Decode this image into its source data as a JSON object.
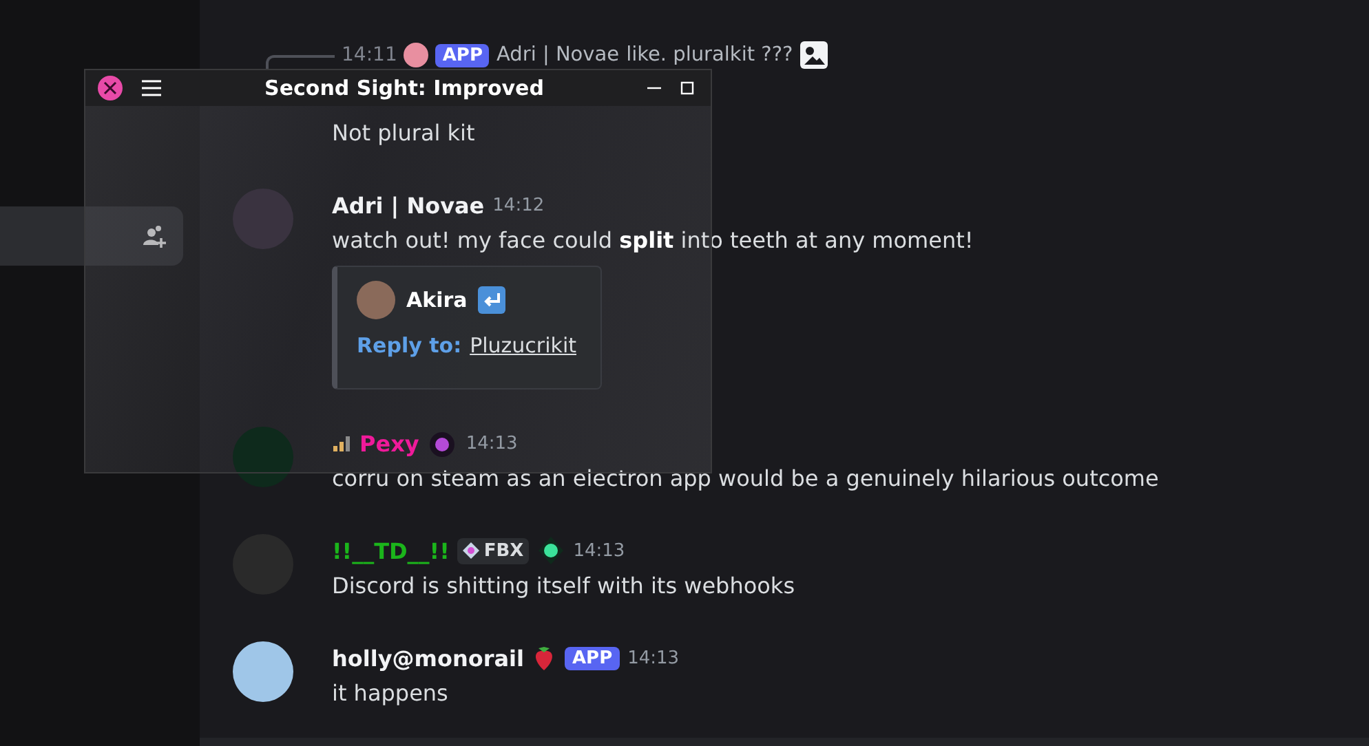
{
  "sidebar": {
    "items": [
      {
        "kind": "add-friend",
        "selected": true
      }
    ]
  },
  "overlay": {
    "title": "Second Sight: Improved"
  },
  "messages": [
    {
      "reply": {
        "time": "14:11",
        "badge": "APP",
        "author": "Adri | Novae",
        "text": "like. pluralkit ???"
      },
      "body": "Not plural kit"
    },
    {
      "author": "Adri | Novae",
      "color": "#f2f3f5",
      "time": "14:12",
      "body": "watch out! my face could **split** into teeth at any moment!",
      "embed": {
        "author": "Akira",
        "label": "Reply to:",
        "link": "Pluzucrikit"
      }
    },
    {
      "author": "Pexy",
      "color": "#ef1a9a",
      "time": "14:13",
      "body": "corru on steam as an electron app would be a genuinely hilarious outcome"
    },
    {
      "author": "!!__TD__!!",
      "color": "#1bb51b",
      "tag": "FBX",
      "time": "14:13",
      "body": "Discord is shitting itself with its webhooks"
    },
    {
      "author": "holly@monorail",
      "color": "#f2f3f5",
      "badge": "APP",
      "time": "14:13",
      "body": "it happens"
    }
  ]
}
